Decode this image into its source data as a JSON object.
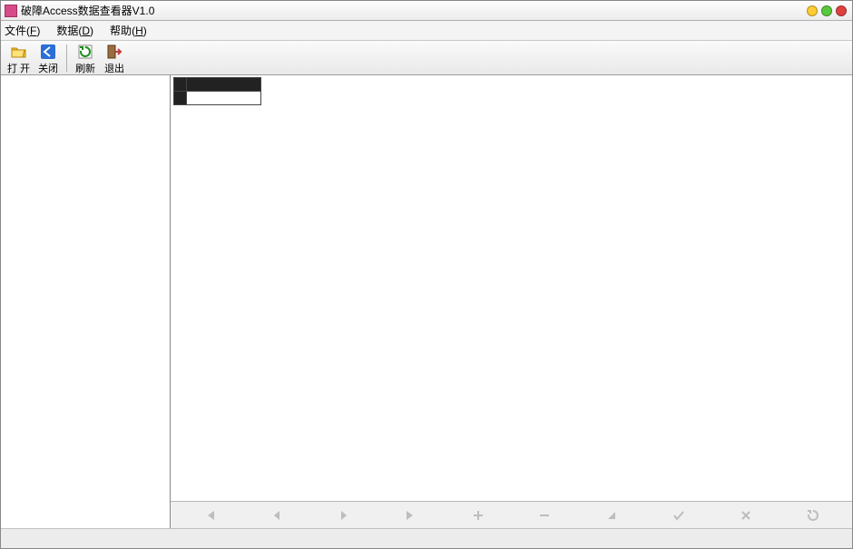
{
  "window": {
    "title": "破障Access数据查看器V1.0"
  },
  "menus": {
    "file": {
      "label": "文件",
      "accel": "F"
    },
    "data": {
      "label": "数据",
      "accel": "D"
    },
    "help": {
      "label": "帮助",
      "accel": "H"
    }
  },
  "toolbar": {
    "open": {
      "label": "打 开"
    },
    "close": {
      "label": "关闭"
    },
    "refresh": {
      "label": "刷新"
    },
    "exit": {
      "label": "退出"
    }
  },
  "grid": {
    "columns": [
      ""
    ],
    "rows": [
      [
        ""
      ]
    ]
  },
  "navigator": {
    "first": "",
    "prev": "",
    "next": "",
    "last": "",
    "insert": "",
    "delete": "",
    "edit": "",
    "post": "",
    "cancel": "",
    "refresh": ""
  }
}
